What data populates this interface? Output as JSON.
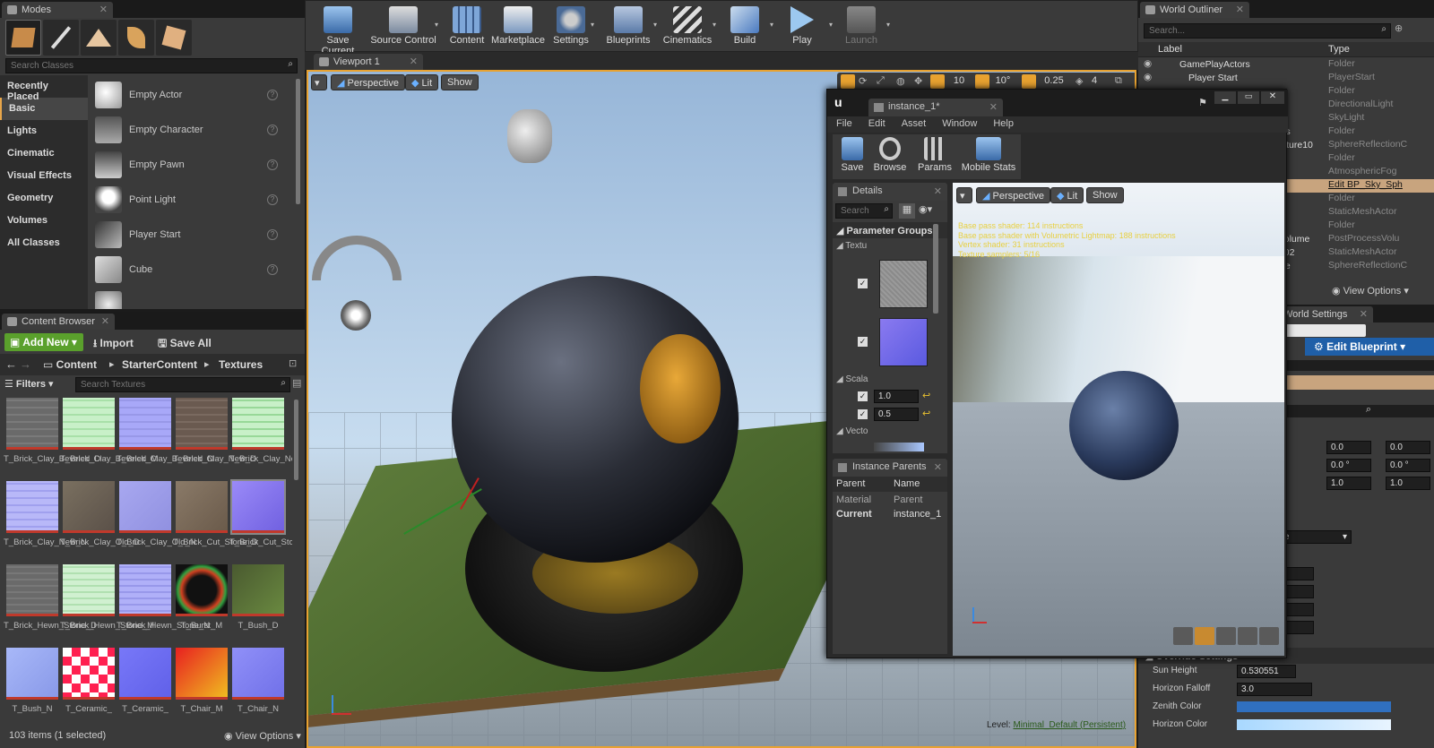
{
  "modes": {
    "tab": "Modes",
    "search_placeholder": "Search Classes",
    "categories": [
      "Recently Placed",
      "Basic",
      "Lights",
      "Cinematic",
      "Visual Effects",
      "Geometry",
      "Volumes",
      "All Classes"
    ],
    "items": [
      "Empty Actor",
      "Empty Character",
      "Empty Pawn",
      "Point Light",
      "Player Start",
      "Cube"
    ]
  },
  "toolbar": {
    "buttons": [
      "Save Current",
      "Source Control",
      "Content",
      "Marketplace",
      "Settings",
      "Blueprints",
      "Cinematics",
      "Build",
      "Play",
      "Launch"
    ]
  },
  "viewport": {
    "tab": "Viewport 1",
    "perspective": "Perspective",
    "lit": "Lit",
    "show": "Show",
    "grid_snap": "10",
    "rot_snap": "10°",
    "scale_snap": "0.25",
    "cam_speed": "4",
    "level_label": "Level:",
    "level_name": "Minimal_Default (Persistent)"
  },
  "content_browser": {
    "tab": "Content Browser",
    "add_new": "Add New",
    "import": "Import",
    "save_all": "Save All",
    "path": [
      "Content",
      "StarterContent",
      "Textures"
    ],
    "filters": "Filters",
    "search_placeholder": "Search Textures",
    "items": [
      "T_Brick_Clay_Beveled_D",
      "T_Brick_Clay_Beveled_M",
      "T_Brick_Clay_Beveled_N",
      "T_Brick_Clay_New_D",
      "T_Brick_Clay_New_M",
      "T_Brick_Clay_New_N",
      "T_Brick_Clay_Old_D",
      "T_Brick_Clay_Old_N",
      "T_Brick_Cut_Stone_D",
      "T_Brick_Cut_Stone_N",
      "T_Brick_Hewn_Stone_D",
      "T_Brick_Hewn_Stone_M",
      "T_Brick_Hewn_Stone_N",
      "T_Burst_M",
      "T_Bush_D",
      "T_Bush_N",
      "T_Ceramic_",
      "T_Ceramic_",
      "T_Chair_M",
      "T_Chair_N"
    ],
    "item_count": "103 items (1 selected)",
    "view_options": "View Options"
  },
  "outliner": {
    "tab": "World Outliner",
    "search_placeholder": "Search...",
    "col_label": "Label",
    "col_type": "Type",
    "rows": [
      {
        "label": "GamePlayActors",
        "type": "Folder"
      },
      {
        "label": "Player Start",
        "type": "PlayerStart"
      },
      {
        "label": "",
        "type": "Folder"
      },
      {
        "label": "",
        "type": "DirectionalLight"
      },
      {
        "label": "",
        "type": "SkyLight"
      },
      {
        "label": "Actors",
        "type": "Folder"
      },
      {
        "label": "nCapture10",
        "type": "SphereReflectionC"
      },
      {
        "label": "",
        "type": "Folder"
      },
      {
        "label": "g",
        "type": "AtmosphericFog"
      },
      {
        "label": "",
        "type": "Edit BP_Sky_Sph"
      },
      {
        "label": "",
        "type": "Folder"
      },
      {
        "label": "",
        "type": "StaticMeshActor"
      },
      {
        "label": "",
        "type": "Folder"
      },
      {
        "label": "essVolume",
        "type": "PostProcessVolu"
      },
      {
        "label": "esh_02",
        "type": "StaticMeshActor"
      },
      {
        "label": "apture",
        "type": "SphereReflectionC"
      }
    ],
    "view_options": "View Options"
  },
  "world_settings": {
    "tab": "World Settings",
    "edit_blueprint": "Edit Blueprint",
    "values": [
      "0.0",
      "0.0",
      "0.0 °",
      "0.0 °",
      "1.0",
      "1.0"
    ],
    "source_label": "urce",
    "override_settings": "Override Settings",
    "sun_height_label": "Sun Height",
    "sun_height": "0.530551",
    "horizon_falloff_label": "Horizon Falloff",
    "horizon_falloff": "3.0",
    "zenith_color_label": "Zenith Color",
    "horizon_color_label": "Horizon Color"
  },
  "material_editor": {
    "tab": "instance_1*",
    "menu": [
      "File",
      "Edit",
      "Asset",
      "Window",
      "Help"
    ],
    "toolbar": [
      "Save",
      "Browse",
      "Params",
      "Mobile Stats"
    ],
    "details_tab": "Details",
    "search_placeholder": "Search",
    "param_groups": "Parameter Groups",
    "group_texture": "Textu",
    "group_scalar": "Scala",
    "group_vector": "Vecto",
    "scalar_values": [
      "1.0",
      "0.5"
    ],
    "parents_tab": "Instance Parents",
    "parents_cols": [
      "Parent",
      "Name"
    ],
    "parents_rows": [
      {
        "parent": "Material",
        "name": "Parent"
      },
      {
        "parent": "Current",
        "name": "instance_1"
      }
    ],
    "perspective": "Perspective",
    "lit": "Lit",
    "show": "Show",
    "stats": [
      "Base pass shader: 114 instructions",
      "Base pass shader with Volumetric Lightmap: 188 instructions",
      "Vertex shader: 31 instructions",
      "Texture samplers: 5/16"
    ]
  }
}
